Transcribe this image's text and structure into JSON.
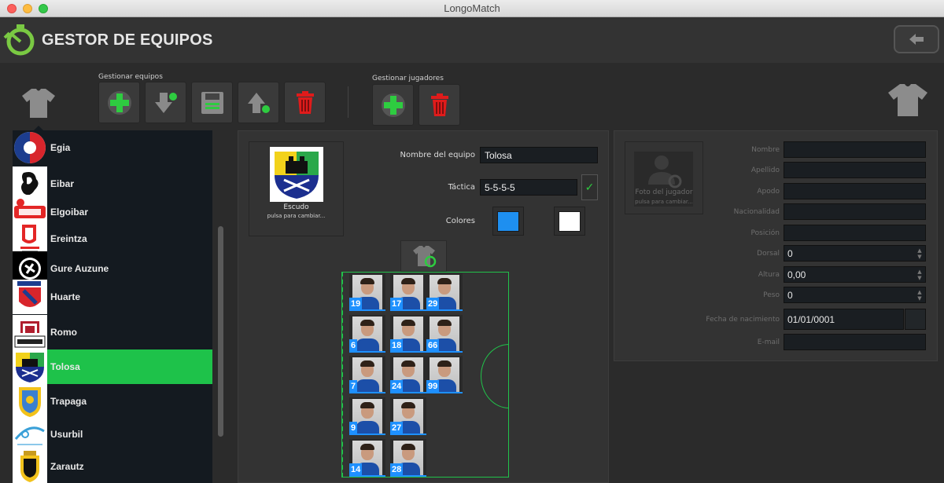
{
  "window": {
    "title": "LongoMatch"
  },
  "header": {
    "title": "GESTOR DE EQUIPOS"
  },
  "toolbar": {
    "team_group_label": "Gestionar equipos",
    "player_group_label": "Gestionar jugadores"
  },
  "teams": [
    {
      "name": "Egia"
    },
    {
      "name": "Eibar"
    },
    {
      "name": "Elgoibar"
    },
    {
      "name": "Ereintza"
    },
    {
      "name": "Gure Auzune"
    },
    {
      "name": "Huarte"
    },
    {
      "name": "Romo"
    },
    {
      "name": "Tolosa",
      "selected": true
    },
    {
      "name": "Trapaga"
    },
    {
      "name": "Usurbil"
    },
    {
      "name": "Zarautz"
    }
  ],
  "team_details": {
    "crest_label": "Escudo",
    "crest_hint": "pulsa para cambiar...",
    "name_label": "Nombre del equipo",
    "name_value": "Tolosa",
    "tactic_label": "Táctica",
    "tactic_value": "5-5-5-5",
    "colors_label": "Colores",
    "color_primary": "#1e8ff0",
    "color_secondary": "#ffffff"
  },
  "formation_numbers": [
    "19",
    "17",
    "29",
    "6",
    "18",
    "66",
    "7",
    "24",
    "99",
    "9",
    "27",
    "14",
    "28"
  ],
  "player_details": {
    "photo_label": "Foto del jugador",
    "photo_hint": "pulsa para cambiar...",
    "name_label": "Nombre",
    "surname_label": "Apellido",
    "nickname_label": "Apodo",
    "nationality_label": "Nacionalidad",
    "position_label": "Posición",
    "number_label": "Dorsal",
    "number_value": "0",
    "height_label": "Altura",
    "height_value": "0,00",
    "weight_label": "Peso",
    "weight_value": "0",
    "birthdate_label": "Fecha de nacimiento",
    "birthdate_value": "01/01/0001",
    "email_label": "E-mail"
  },
  "colors": {
    "accent": "#1ec24a",
    "field_line": "#21c24a",
    "number_badge": "#1e90ff"
  }
}
